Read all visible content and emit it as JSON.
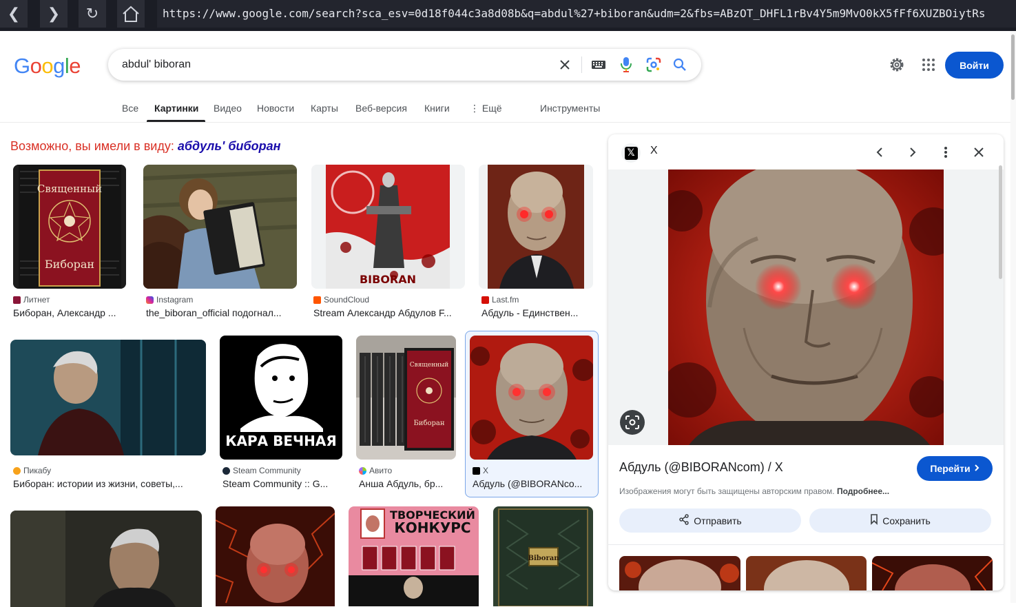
{
  "browser": {
    "url": "https://www.google.com/search?sca_esv=0d18f044c3a8d08b&q=abdul%27+biboran&udm=2&fbs=ABzOT_DHFL1rBv4Y5m9MvO0kX5fFf6XUZBOiytRs"
  },
  "header": {
    "query": "abdul' biboran",
    "signin_label": "Войти"
  },
  "tabs": [
    {
      "label": "Все"
    },
    {
      "label": "Картинки"
    },
    {
      "label": "Видео"
    },
    {
      "label": "Новости"
    },
    {
      "label": "Карты"
    },
    {
      "label": "Веб-версия"
    },
    {
      "label": "Книги"
    },
    {
      "label": "⋮ Ещё"
    },
    {
      "label": "Инструменты"
    }
  ],
  "did_you_mean": {
    "prefix": "Возможно, вы имели в виду:",
    "suggestion": "абдуль' биборан"
  },
  "results": [
    {
      "source": "Литнет",
      "caption": "Биборан, Александр ...",
      "thumb_text": "Священный Биборан",
      "fav_color": "#8a1538"
    },
    {
      "source": "Instagram",
      "caption": "the_biboran_official подогнал...",
      "thumb_text": "",
      "fav_color": "#d6249f"
    },
    {
      "source": "SoundCloud",
      "caption": "Stream Александр Абдулов F...",
      "thumb_text": "BIBORAN",
      "fav_color": "#ff5500"
    },
    {
      "source": "Last.fm",
      "caption": "Абдуль - Единствен...",
      "thumb_text": "",
      "fav_color": "#d51007"
    },
    {
      "source": "Пикабу",
      "caption": "Биборан: истории из жизни, советы,...",
      "thumb_text": "",
      "fav_color": "#f7a21b"
    },
    {
      "source": "Steam Community",
      "caption": "Steam Community :: G...",
      "thumb_text": "КАРА ВЕЧНАЯ",
      "fav_color": "#1b2838"
    },
    {
      "source": "Авито",
      "caption": "Анша Абдуль, бр...",
      "thumb_text": "",
      "fav_color": "#97cf26"
    },
    {
      "source": "X",
      "caption": "Абдуль (@BIBORANco...",
      "thumb_text": "",
      "fav_color": "#000000"
    },
    {
      "source": "",
      "caption": "",
      "thumb_text": "",
      "fav_color": ""
    },
    {
      "source": "",
      "caption": "",
      "thumb_text": "",
      "fav_color": ""
    },
    {
      "source": "",
      "caption": "",
      "thumb_text": "ТВОРЧЕСКИЙ КОНКУРС",
      "fav_color": ""
    },
    {
      "source": "",
      "caption": "",
      "thumb_text": "Biboran",
      "fav_color": ""
    }
  ],
  "panel": {
    "site": "X",
    "title": "Абдуль (@BIBORANcom) / X",
    "go_label": "Перейти",
    "copyright": "Изображения могут быть защищены авторским правом.",
    "more_label": "Подробнее...",
    "share_label": "Отправить",
    "save_label": "Сохранить"
  },
  "colors": {
    "accent": "#0b57d0",
    "did_you_mean": "#d93025",
    "link": "#1a0dab"
  }
}
